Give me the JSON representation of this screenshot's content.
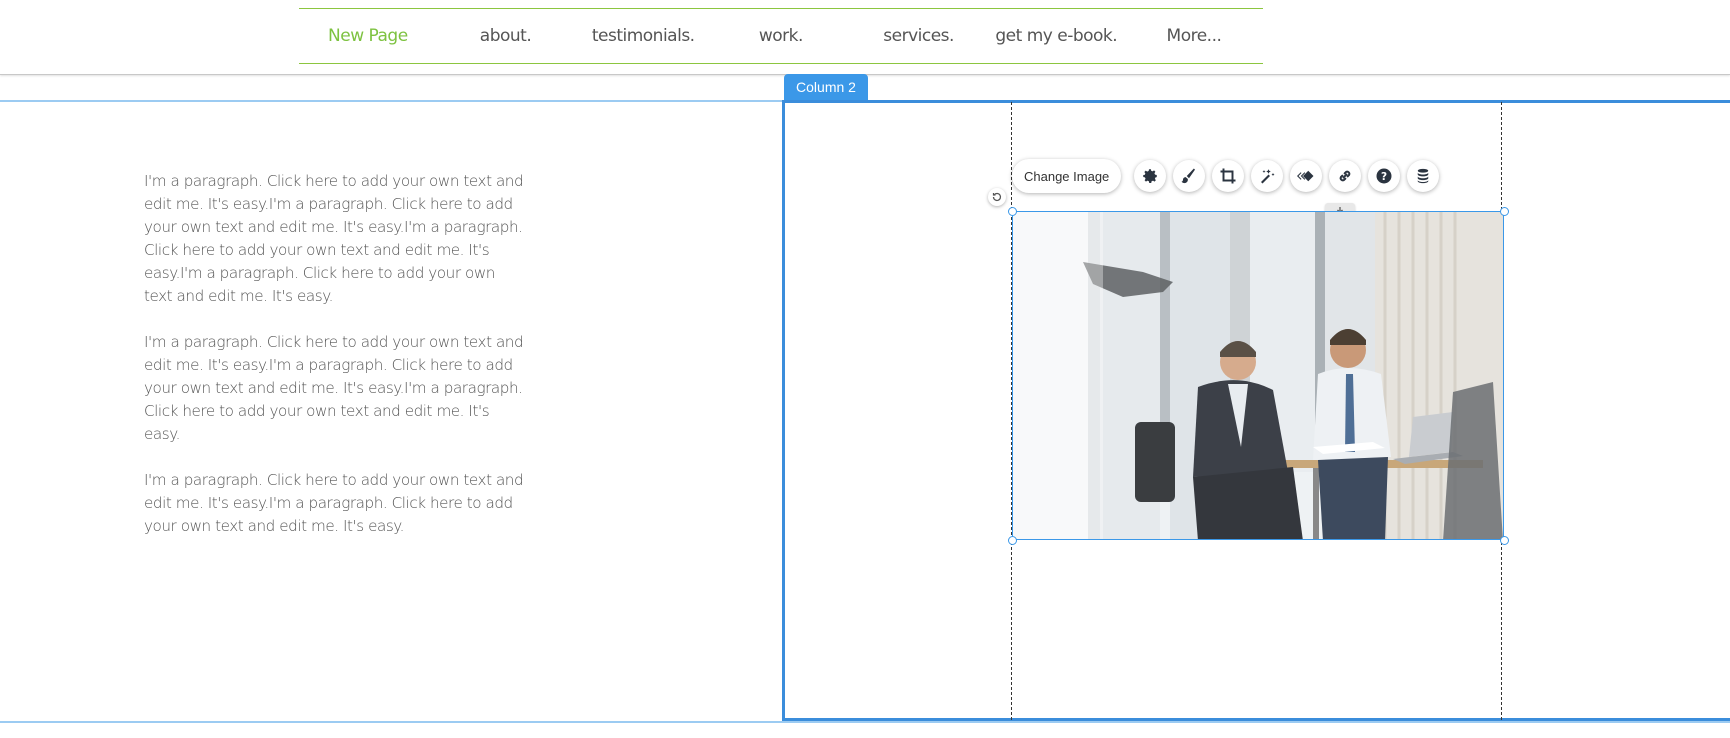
{
  "nav": {
    "items": [
      {
        "label": "New Page",
        "active": true
      },
      {
        "label": "about.",
        "active": false
      },
      {
        "label": "testimonials.",
        "active": false
      },
      {
        "label": "work.",
        "active": false
      },
      {
        "label": "services.",
        "active": false
      },
      {
        "label": "get my e-book.",
        "active": false
      },
      {
        "label": "More...",
        "active": false
      }
    ],
    "accent_color": "#7dc240"
  },
  "column_tag": "Column 2",
  "paragraphs": [
    "I'm a paragraph. Click here to add your own text and edit me. It's easy.I'm a paragraph. Click here to add your own text and edit me. It's easy.I'm a paragraph. Click here to add your own text and edit me. It's easy.I'm a paragraph. Click here to add your own text and edit me. It's easy.",
    "I'm a paragraph. Click here to add your own text and edit me. It's easy.I'm a paragraph. Click here to add your own text and edit me. It's easy.I'm a paragraph. Click here to add your own text and edit me. It's easy.",
    "I'm a paragraph. Click here to add your own text and edit me. It's easy.I'm a paragraph. Click here to add your own text and edit me. It's easy."
  ],
  "image_toolbar": {
    "change_image_label": "Change Image",
    "tools": [
      "settings-icon",
      "design-brush-icon",
      "crop-icon",
      "magic-wand-icon",
      "animation-icon",
      "link-icon",
      "help-icon",
      "data-icon"
    ]
  },
  "selection_color": "#3b8ddb"
}
